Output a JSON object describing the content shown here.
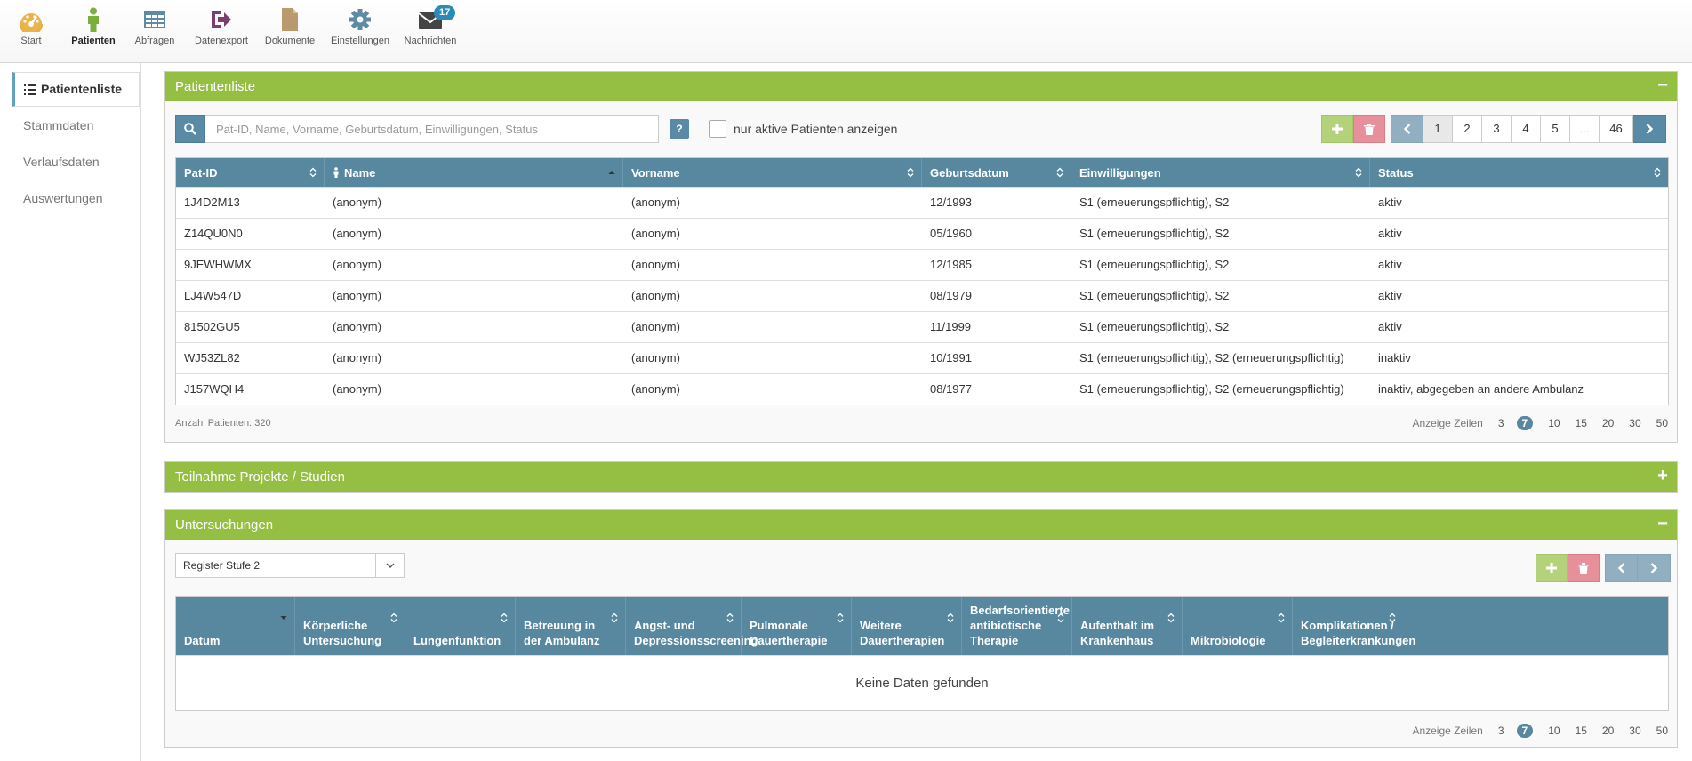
{
  "nav": {
    "items": [
      {
        "label": "Start",
        "icon": "dashboard-icon"
      },
      {
        "label": "Patienten",
        "icon": "person-icon"
      },
      {
        "label": "Abfragen",
        "icon": "table-icon"
      },
      {
        "label": "Datenexport",
        "icon": "export-icon"
      },
      {
        "label": "Dokumente",
        "icon": "document-icon"
      },
      {
        "label": "Einstellungen",
        "icon": "gear-icon"
      },
      {
        "label": "Nachrichten",
        "icon": "envelope-icon"
      }
    ],
    "messages_badge": "17",
    "active": "Patienten"
  },
  "sidebar": {
    "items": [
      {
        "label": "Patientenliste"
      },
      {
        "label": "Stammdaten"
      },
      {
        "label": "Verlaufsdaten"
      },
      {
        "label": "Auswertungen"
      }
    ]
  },
  "patientlist": {
    "title": "Patientenliste",
    "toggle": "−",
    "search_placeholder": "Pat-ID, Name, Vorname, Geburtsdatum, Einwilligungen, Status",
    "help": "?",
    "only_active_label": "nur aktive Patienten anzeigen",
    "pages": [
      "1",
      "2",
      "3",
      "4",
      "5",
      "...",
      "46"
    ],
    "current_page": "1",
    "columns": [
      "Pat-ID",
      "Name",
      "Vorname",
      "Geburtsdatum",
      "Einwilligungen",
      "Status"
    ],
    "rows": [
      [
        "1J4D2M13",
        "(anonym)",
        "(anonym)",
        "12/1993",
        "S1 (erneuerungspflichtig), S2",
        "aktiv"
      ],
      [
        "Z14QU0N0",
        "(anonym)",
        "(anonym)",
        "05/1960",
        "S1 (erneuerungspflichtig), S2",
        "aktiv"
      ],
      [
        "9JEWHWMX",
        "(anonym)",
        "(anonym)",
        "12/1985",
        "S1 (erneuerungspflichtig), S2",
        "aktiv"
      ],
      [
        "LJ4W547D",
        "(anonym)",
        "(anonym)",
        "08/1979",
        "S1 (erneuerungspflichtig), S2",
        "aktiv"
      ],
      [
        "81502GU5",
        "(anonym)",
        "(anonym)",
        "11/1999",
        "S1 (erneuerungspflichtig), S2",
        "aktiv"
      ],
      [
        "WJ53ZL82",
        "(anonym)",
        "(anonym)",
        "10/1991",
        "S1 (erneuerungspflichtig), S2 (erneuerungspflichtig)",
        "inaktiv"
      ],
      [
        "J157WQH4",
        "(anonym)",
        "(anonym)",
        "08/1977",
        "S1 (erneuerungspflichtig), S2 (erneuerungspflichtig)",
        "inaktiv, abgegeben an andere Ambulanz"
      ]
    ],
    "count_label": "Anzahl Patienten: 320",
    "rows_label": "Anzeige Zeilen",
    "rows_options": [
      "3",
      "7",
      "10",
      "15",
      "20",
      "30",
      "50"
    ],
    "rows_selected": "7"
  },
  "projects": {
    "title": "Teilnahme Projekte / Studien",
    "toggle": "+"
  },
  "exams": {
    "title": "Untersuchungen",
    "toggle": "−",
    "select_value": "Register Stufe 2",
    "columns": [
      "Datum",
      "Körperliche Untersuchung",
      "Lungenfunktion",
      "Betreuung in der Ambulanz",
      "Angst- und Depressionsscreening",
      "Pulmonale Dauertherapie",
      "Weitere Dauertherapien",
      "Bedarfsorientierte antibiotische Therapie",
      "Aufenthalt im Krankenhaus",
      "Mikrobiologie",
      "Komplikationen / Begleiterkrankungen"
    ],
    "empty_text": "Keine Daten gefunden",
    "rows_label": "Anzeige Zeilen",
    "rows_options": [
      "3",
      "7",
      "10",
      "15",
      "20",
      "30",
      "50"
    ],
    "rows_selected": "7"
  },
  "colors": {
    "panel_green": "#94bf42",
    "table_header": "#58889f",
    "button_blue": "#5a8ba6",
    "add_green": "#b4d27a",
    "delete_red": "#e78f9a",
    "badge_blue": "#2a8ab8"
  }
}
